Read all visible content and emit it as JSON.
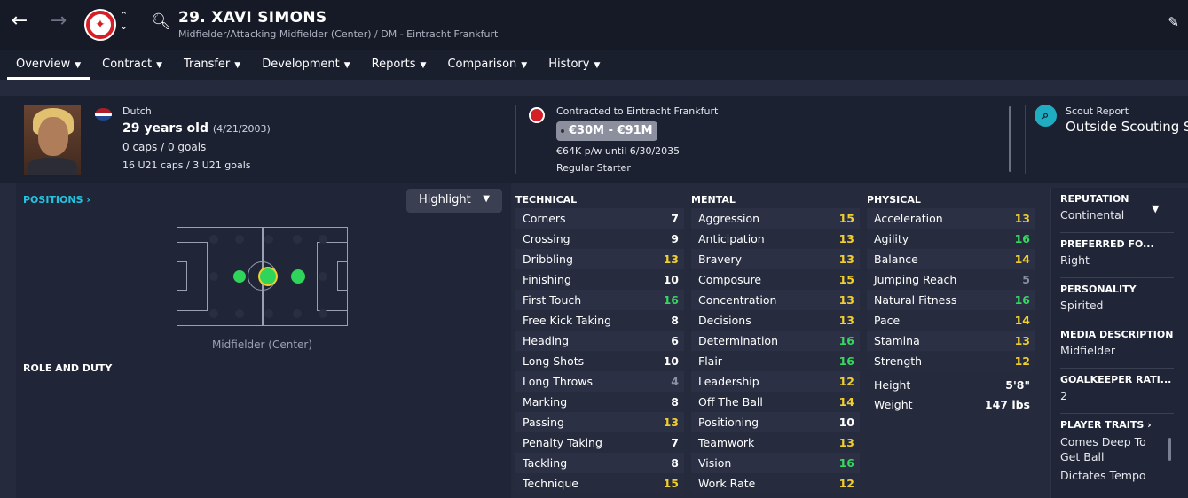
{
  "header": {
    "player_name": "29. XAVI SIMONS",
    "player_subtitle": "Midfielder/Attacking Midfielder (Center) / DM - Eintracht Frankfurt"
  },
  "tabs": [
    {
      "label": "Overview"
    },
    {
      "label": "Contract"
    },
    {
      "label": "Transfer"
    },
    {
      "label": "Development"
    },
    {
      "label": "Reports"
    },
    {
      "label": "Comparison"
    },
    {
      "label": "History"
    }
  ],
  "info": {
    "nationality": "Dutch",
    "age": "29 years old",
    "dob": "(4/21/2003)",
    "caps": "0 caps / 0 goals",
    "u21": "16 U21 caps / 3 U21 goals",
    "contract_label": "Contracted to Eintracht Frankfurt",
    "value": "€30M - €91M",
    "wage": "€64K p/w until 6/30/2035",
    "status": "Regular Starter",
    "scout_label": "Scout Report",
    "scout_value": "Outside Scouting Scope"
  },
  "positions": {
    "label": "POSITIONS",
    "highlight_label": "Highlight",
    "position_name": "Midfielder (Center)",
    "role_label": "ROLE AND DUTY"
  },
  "technical": {
    "title": "TECHNICAL",
    "rows": [
      {
        "name": "Corners",
        "value": "7",
        "c": "w"
      },
      {
        "name": "Crossing",
        "value": "9",
        "c": "w"
      },
      {
        "name": "Dribbling",
        "value": "13",
        "c": "y"
      },
      {
        "name": "Finishing",
        "value": "10",
        "c": "w"
      },
      {
        "name": "First Touch",
        "value": "16",
        "c": "g"
      },
      {
        "name": "Free Kick Taking",
        "value": "8",
        "c": "w"
      },
      {
        "name": "Heading",
        "value": "6",
        "c": "w"
      },
      {
        "name": "Long Shots",
        "value": "10",
        "c": "w"
      },
      {
        "name": "Long Throws",
        "value": "4",
        "c": "gr"
      },
      {
        "name": "Marking",
        "value": "8",
        "c": "w"
      },
      {
        "name": "Passing",
        "value": "13",
        "c": "y"
      },
      {
        "name": "Penalty Taking",
        "value": "7",
        "c": "w"
      },
      {
        "name": "Tackling",
        "value": "8",
        "c": "w"
      },
      {
        "name": "Technique",
        "value": "15",
        "c": "y"
      }
    ]
  },
  "mental": {
    "title": "MENTAL",
    "rows": [
      {
        "name": "Aggression",
        "value": "15",
        "c": "y"
      },
      {
        "name": "Anticipation",
        "value": "13",
        "c": "y"
      },
      {
        "name": "Bravery",
        "value": "13",
        "c": "y"
      },
      {
        "name": "Composure",
        "value": "15",
        "c": "y"
      },
      {
        "name": "Concentration",
        "value": "13",
        "c": "y"
      },
      {
        "name": "Decisions",
        "value": "13",
        "c": "y"
      },
      {
        "name": "Determination",
        "value": "16",
        "c": "g"
      },
      {
        "name": "Flair",
        "value": "16",
        "c": "g"
      },
      {
        "name": "Leadership",
        "value": "12",
        "c": "y"
      },
      {
        "name": "Off The Ball",
        "value": "14",
        "c": "y"
      },
      {
        "name": "Positioning",
        "value": "10",
        "c": "w"
      },
      {
        "name": "Teamwork",
        "value": "13",
        "c": "y"
      },
      {
        "name": "Vision",
        "value": "16",
        "c": "g"
      },
      {
        "name": "Work Rate",
        "value": "12",
        "c": "y"
      }
    ]
  },
  "physical": {
    "title": "PHYSICAL",
    "rows": [
      {
        "name": "Acceleration",
        "value": "13",
        "c": "y"
      },
      {
        "name": "Agility",
        "value": "16",
        "c": "g"
      },
      {
        "name": "Balance",
        "value": "14",
        "c": "y"
      },
      {
        "name": "Jumping Reach",
        "value": "5",
        "c": "gr"
      },
      {
        "name": "Natural Fitness",
        "value": "16",
        "c": "g"
      },
      {
        "name": "Pace",
        "value": "14",
        "c": "y"
      },
      {
        "name": "Stamina",
        "value": "13",
        "c": "y"
      },
      {
        "name": "Strength",
        "value": "12",
        "c": "y"
      }
    ],
    "height_label": "Height",
    "height_value": "5'8\"",
    "weight_label": "Weight",
    "weight_value": "147 lbs"
  },
  "sidebar": {
    "reputation_h": "REPUTATION",
    "reputation_v": "Continental",
    "foot_h": "PREFERRED FO...",
    "foot_v": "Right",
    "personality_h": "PERSONALITY",
    "personality_v": "Spirited",
    "media_h": "MEDIA DESCRIPTION",
    "media_v": "Midfielder",
    "gk_h": "GOALKEEPER RATI...",
    "gk_v": "2",
    "traits_h": "PLAYER TRAITS",
    "trait_1": "Comes Deep To Get Ball",
    "trait_2": "Dictates Tempo"
  },
  "colors": {
    "accent_cyan": "#24c4e0",
    "attr_green": "#36d860",
    "attr_yellow": "#f1cf2e",
    "attr_grey": "#8c91a1"
  }
}
